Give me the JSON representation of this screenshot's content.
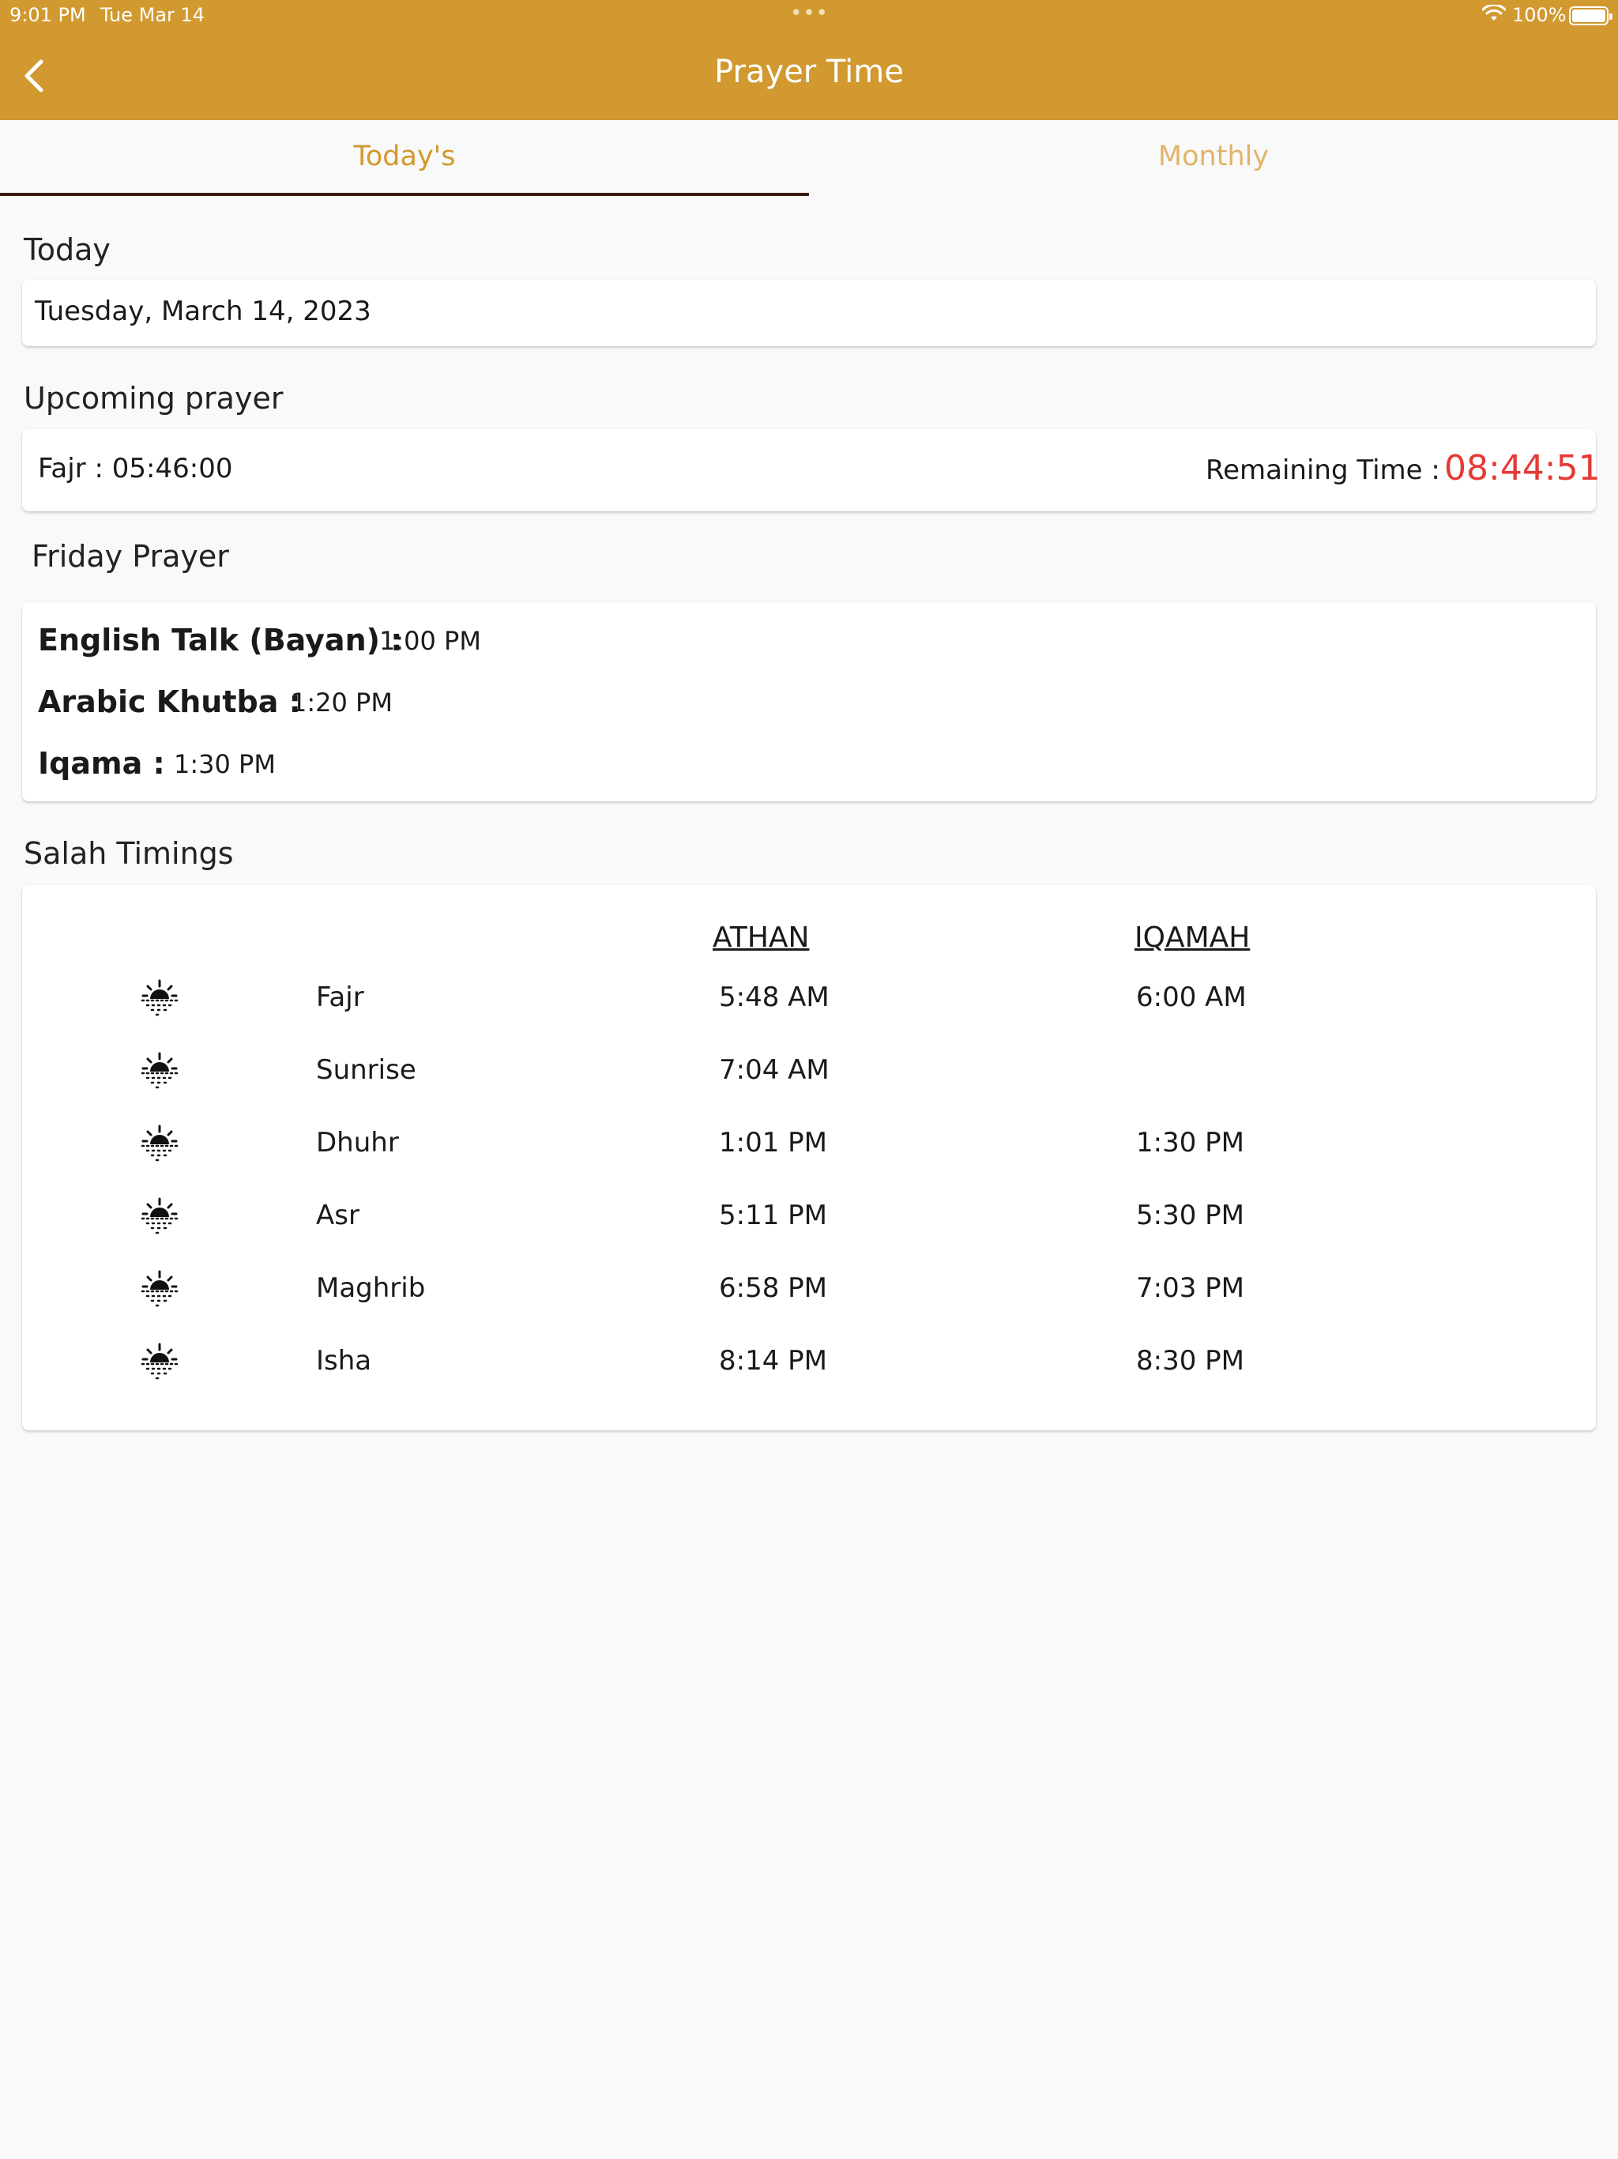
{
  "status_bar": {
    "time": "9:01 PM",
    "date": "Tue Mar 14",
    "dots": "•••",
    "battery": "100%"
  },
  "nav": {
    "title": "Prayer Time",
    "back_icon": "chevron-left-icon"
  },
  "tabs": [
    {
      "label": "Today's",
      "active": true
    },
    {
      "label": "Monthly",
      "active": false
    }
  ],
  "today": {
    "label": "Today",
    "date": "Tuesday, March 14, 2023"
  },
  "upcoming": {
    "label": "Upcoming prayer",
    "prayer": "Fajr : 05:46:00",
    "remaining_label": "Remaining Time :",
    "remaining_value": "08:44:51"
  },
  "friday": {
    "label": "Friday Prayer",
    "items": [
      {
        "name": "English Talk (Bayan) :",
        "time": "1:00 PM"
      },
      {
        "name": "Arabic Khutba :",
        "time": "1:20 PM"
      },
      {
        "name": "Iqama :",
        "time": "1:30 PM"
      }
    ]
  },
  "salah": {
    "label": "Salah Timings",
    "headers": {
      "athan": "ATHAN",
      "iqamah": "IQAMAH"
    },
    "rows": [
      {
        "icon": "sun-icon",
        "name": "Fajr",
        "athan": "5:48 AM",
        "iqamah": "6:00 AM"
      },
      {
        "icon": "sun-icon",
        "name": "Sunrise",
        "athan": "7:04 AM",
        "iqamah": ""
      },
      {
        "icon": "sun-icon",
        "name": "Dhuhr",
        "athan": "1:01 PM",
        "iqamah": "1:30 PM"
      },
      {
        "icon": "sun-icon",
        "name": "Asr",
        "athan": "5:11 PM",
        "iqamah": "5:30 PM"
      },
      {
        "icon": "sun-icon",
        "name": "Maghrib",
        "athan": "6:58 PM",
        "iqamah": "7:03 PM"
      },
      {
        "icon": "sun-icon",
        "name": "Isha",
        "athan": "8:14 PM",
        "iqamah": "8:30 PM"
      }
    ]
  },
  "colors": {
    "brand": "#d1992f",
    "tab_inactive": "#e0b567",
    "countdown": "#e53935"
  }
}
